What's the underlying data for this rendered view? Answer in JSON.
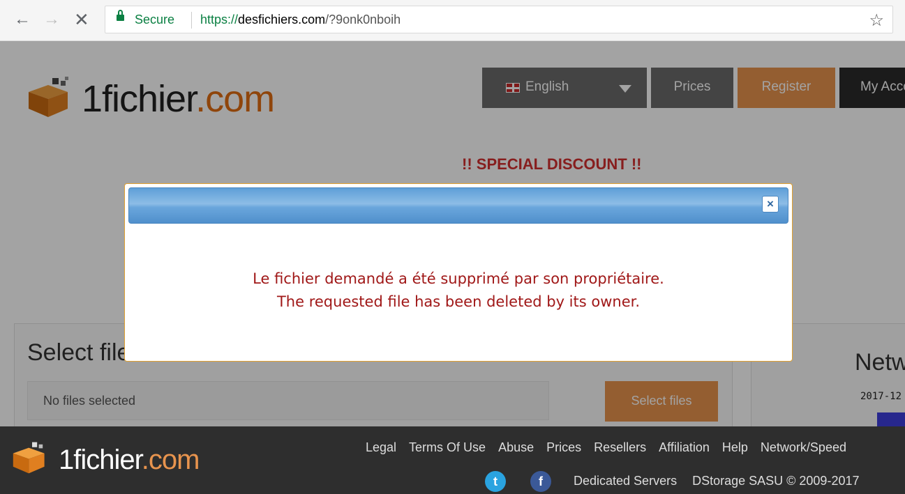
{
  "browser": {
    "secure_label": "Secure",
    "url_scheme": "https://",
    "url_host": "desfichiers.com",
    "url_path": "/?9onk0nboih"
  },
  "header": {
    "logo_name": "1fichier",
    "logo_tld": ".com",
    "nav": {
      "language": "English",
      "prices": "Prices",
      "register": "Register",
      "account": "My Account"
    }
  },
  "banner": {
    "discount": "!! SPECIAL DISCOUNT !!"
  },
  "upload": {
    "title": "Select files to send :",
    "placeholder": "No files selected",
    "button": "Select files"
  },
  "network": {
    "title": "Network",
    "date": "2017-12"
  },
  "modal": {
    "message_fr": "Le fichier demandé a été supprimé par son propriétaire.",
    "message_en": "The requested file has been deleted by its owner.",
    "close_symbol": "×"
  },
  "footer": {
    "logo_name": "1fichier",
    "logo_tld": ".com",
    "links": [
      "Legal",
      "Terms Of Use",
      "Abuse",
      "Prices",
      "Resellers",
      "Affiliation",
      "Help",
      "Network/Speed"
    ],
    "twitter_glyph": "t",
    "facebook_glyph": "f",
    "dedicated": "Dedicated Servers",
    "copyright": "DStorage SASU © 2009-2017"
  },
  "colors": {
    "accent_orange": "#e8944e",
    "secure_green": "#0b8043",
    "discount_red": "#d32f2f",
    "modal_message": "#a01818"
  }
}
